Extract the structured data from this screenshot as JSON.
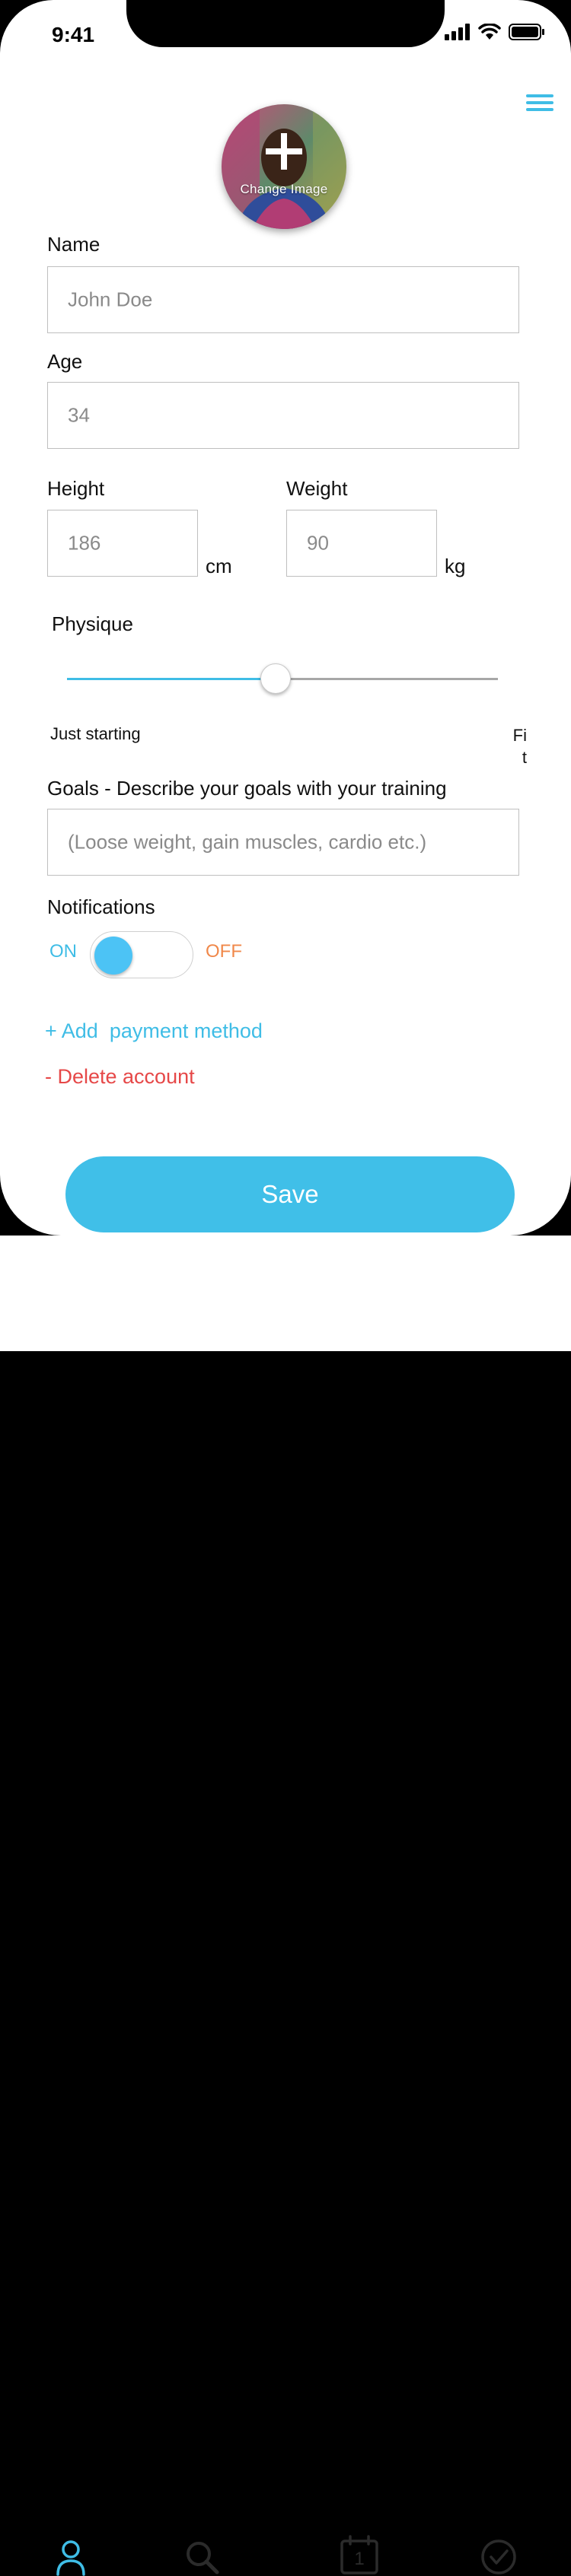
{
  "status_bar": {
    "time": "9:41"
  },
  "profile": {
    "change_image_label": "Change Image"
  },
  "form": {
    "name": {
      "label": "Name",
      "value": "John Doe"
    },
    "age": {
      "label": "Age",
      "value": "34"
    },
    "height": {
      "label": "Height",
      "value": "186",
      "unit": "cm"
    },
    "weight": {
      "label": "Weight",
      "value": "90",
      "unit": "kg"
    },
    "physique": {
      "label": "Physique",
      "min_label": "Just starting",
      "max_label": "Fi\nt",
      "value_fraction": 0.48
    },
    "goals": {
      "label": "Goals - Describe your goals with your training",
      "placeholder": "(Loose weight, gain muscles, cardio etc.)"
    },
    "notifications": {
      "label": "Notifications",
      "on_label": "ON",
      "off_label": "OFF",
      "state": "on"
    }
  },
  "links": {
    "add_payment": "+ Add  payment method",
    "delete_account": "- Delete account"
  },
  "save_label": "Save",
  "tabbar": {
    "items": [
      "profile-icon",
      "search-icon",
      "calendar-icon",
      "check-circle-icon"
    ],
    "calendar_day": "1"
  },
  "colors": {
    "accent": "#40bfe8",
    "delete": "#e64848",
    "off": "#f0884a"
  }
}
